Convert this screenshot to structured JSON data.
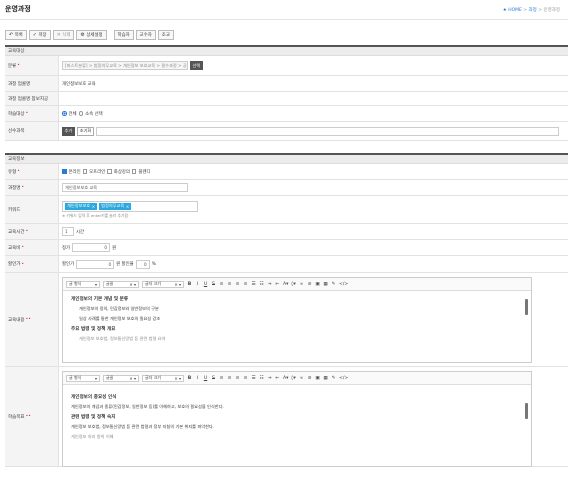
{
  "page": {
    "title": "운영과정"
  },
  "breadcrumb": [
    "HOME",
    "과정",
    "운영과정"
  ],
  "toolbar": {
    "list": "목록",
    "save": "저장",
    "delete": "삭제",
    "detail": "상세설정",
    "tabs": [
      "학습자",
      "교수자",
      "조교"
    ]
  },
  "section1": {
    "title": "교육대상",
    "category": {
      "label": "분류",
      "path": "[퍼스트분류] > 법정의무교육 > 개인정보 보호교육 > 필수과정 > 공...",
      "button": "선택"
    },
    "course_code": {
      "label": "과정 업콜명",
      "value": "개인정보보호 교육"
    },
    "course_code2": {
      "label": "과정 업콜명 참보지공",
      "value": ""
    },
    "target": {
      "label": "학습대상",
      "options": [
        "전체",
        "소속 선택"
      ],
      "selected": 0
    },
    "prereq": {
      "label": "선수과목",
      "add": "추가",
      "reset": "초기화"
    }
  },
  "section2": {
    "title": "교육정보",
    "type": {
      "label": "유형",
      "options": [
        "온라인",
        "오프라인",
        "화상강의",
        "블렌디"
      ],
      "checked": [
        true,
        false,
        false,
        false
      ]
    },
    "name": {
      "label": "과정명",
      "value": "개인정보보호 교육"
    },
    "keywords": {
      "label": "키워드",
      "tags": [
        "개인정보보호",
        "법정의무교육"
      ],
      "hint": "※ 키워드 입력 후 enter키를 눌러 추가합"
    },
    "hours": {
      "label": "교육시간",
      "value": "1",
      "unit": "시간"
    },
    "fee": {
      "label": "교육비",
      "prefix": "정가",
      "value": "0",
      "unit": "원"
    },
    "discount": {
      "label": "할인가",
      "prefix": "할인가",
      "value": "0",
      "unit1": "원  할인율",
      "value2": "0",
      "unit2": "%"
    }
  },
  "editor_toolbar": {
    "para": "글 형식",
    "font": "글꼴",
    "size": "글자 크기"
  },
  "content": {
    "label": "교육내용",
    "heading": "개인정보의 기본 개념 및 분류",
    "lines": [
      "개인정보의 정의, 민감정보와 일반정보의 구분",
      "일상 사례를 통한 개인정보 보호의 필요성 강조"
    ],
    "heading2": "주요 법령 및 정책 개요",
    "cut": "개인정보 보호법, 정보통신망법 등 관련 법령 요약"
  },
  "goal": {
    "label": "학습목표",
    "heading": "개인정보의 중요성 인식",
    "line1": "개인정보의 개념과 종류(민감정보, 일반정보 등)를 이해하고, 보호의 필요성을 인식한다.",
    "heading2": "관련 법령 및 정책 숙지",
    "line2": "개인정보 보호법, 정보통신망법 등 관련 법령과 정부 지침의 기본 취지를 파악한다.",
    "cut": "개인정보 처리 원칙 이해"
  }
}
